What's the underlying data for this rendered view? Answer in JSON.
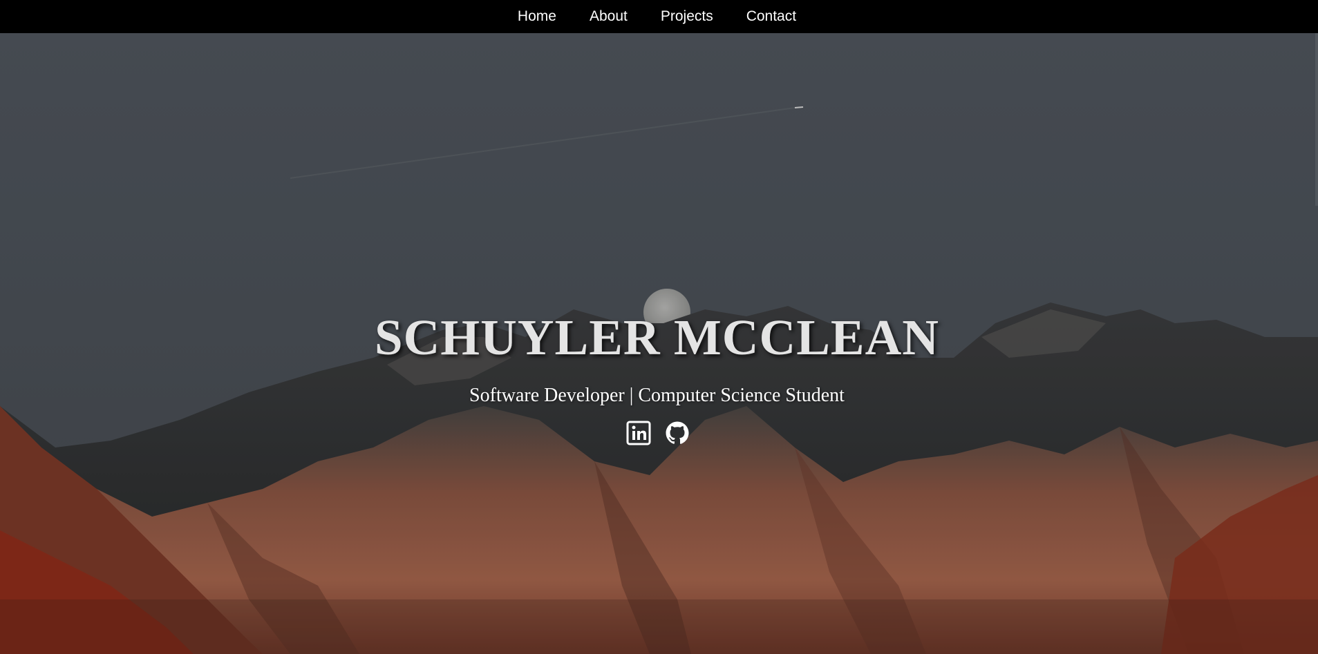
{
  "nav": {
    "items": [
      {
        "label": "Home"
      },
      {
        "label": "About"
      },
      {
        "label": "Projects"
      },
      {
        "label": "Contact"
      }
    ]
  },
  "hero": {
    "title": "SCHUYLER MCCLEAN",
    "subtitle": "Software Developer | Computer Science Student",
    "social": [
      {
        "icon": "linkedin-icon",
        "name": "LinkedIn"
      },
      {
        "icon": "github-icon",
        "name": "GitHub"
      }
    ]
  },
  "colors": {
    "nav_bg": "#000000",
    "nav_text": "#ffffff",
    "sky": "#4b5159",
    "mountain_dark": "#3a3b3d",
    "mountain_rust": "#9a5a43",
    "forest_red": "#8a2f1e"
  }
}
